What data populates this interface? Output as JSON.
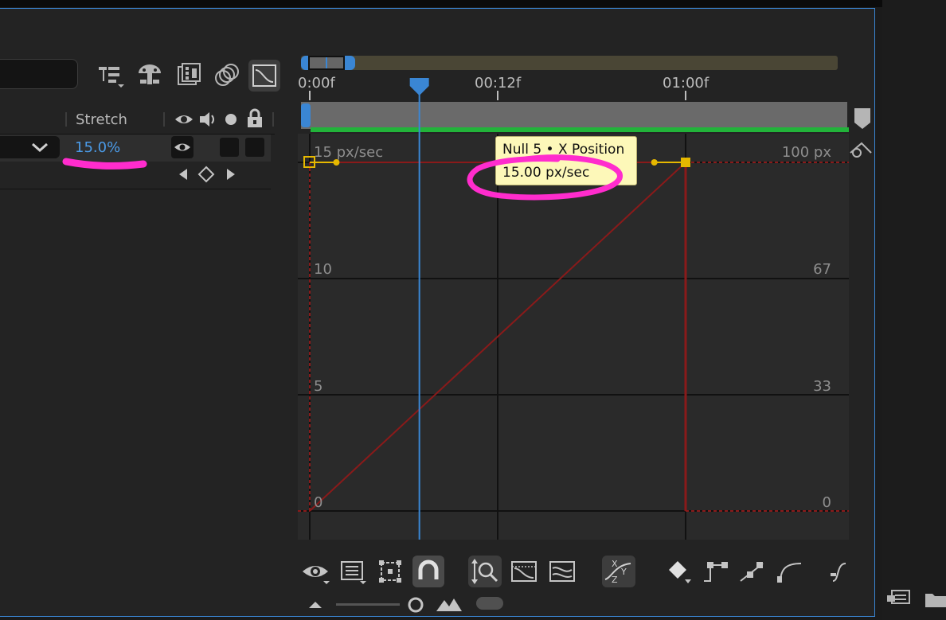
{
  "layer_columns": {
    "stretch_label": "Stretch",
    "stretch_value": "15.0%"
  },
  "switch_icons": [
    "eye-icon",
    "audio-icon",
    "solo-icon",
    "lock-icon"
  ],
  "top_toolbar_icons": [
    "shy-layers-icon",
    "comp-flowchart-icon",
    "frame-blending-icon",
    "motion-blur-icon",
    "graph-editor-icon"
  ],
  "timeline": {
    "ticks": [
      "0:00f",
      "00:12f",
      "01:00f"
    ],
    "current_time_frame": 7
  },
  "graph": {
    "tooltip_title": "Null 5 • X Position",
    "tooltip_value": "15.00 px/sec",
    "speed_labels": [
      "15 px/sec",
      "10",
      "5",
      "0"
    ],
    "value_labels": [
      "100 px",
      "67",
      "33",
      "0"
    ]
  },
  "chart_data": {
    "type": "line",
    "title": "",
    "x_ticks": [
      "0:00f",
      "00:12f",
      "01:00f"
    ],
    "xlim_frames": [
      0,
      27
    ],
    "left_axis": {
      "labels": [
        "15 px/sec",
        "10",
        "5",
        "0"
      ],
      "range": [
        0,
        15
      ]
    },
    "right_axis": {
      "labels": [
        "100 px",
        "67",
        "33",
        "0"
      ],
      "range": [
        0,
        100
      ]
    },
    "series": [
      {
        "kind": "value",
        "x": [
          0,
          24
        ],
        "y": [
          0,
          100
        ]
      },
      {
        "kind": "speed",
        "x": [
          0,
          24
        ],
        "y": [
          15,
          15
        ]
      }
    ],
    "keyframes_frames": [
      0,
      24
    ],
    "playhead_frame": 7,
    "hover_readout": "15.00 px/sec",
    "grid": true,
    "colors": {
      "curve": "#8a1a1a",
      "keyframe": "#e6b800",
      "playhead": "#3a86d4",
      "work_area": "#22b33a"
    }
  },
  "zoom_controls": [
    "zoom-out-icon",
    "zoom-slider",
    "zoom-in-icon"
  ],
  "colors": {
    "accent": "#3a86d4",
    "highlight": "#ff2ccd",
    "tooltip_bg": "#fdf8b9"
  }
}
